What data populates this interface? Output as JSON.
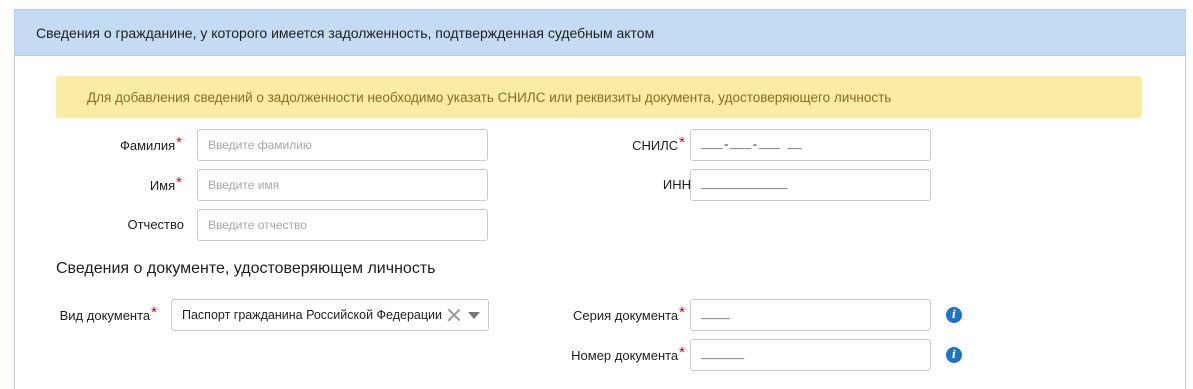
{
  "panel": {
    "title": "Сведения о гражданине, у которого имеется задолженность, подтвержденная судебным актом"
  },
  "notice": {
    "text": "Для добавления сведений о задолженности необходимо указать СНИЛС или реквизиты документа, удостоверяющего личность"
  },
  "person": {
    "surname": {
      "label": "Фамилия",
      "required": "*",
      "placeholder": "Введите фамилию",
      "value": ""
    },
    "name": {
      "label": "Имя",
      "required": "*",
      "placeholder": "Введите имя",
      "value": ""
    },
    "patronymic": {
      "label": "Отчество",
      "placeholder": "Введите отчество",
      "value": ""
    },
    "snils": {
      "label": "СНИЛС",
      "required": "*",
      "value": "___-___-___ __"
    },
    "inn": {
      "label": "ИНН",
      "value": "____________"
    }
  },
  "document": {
    "section_title": "Сведения о документе, удостоверяющем личность",
    "type": {
      "label": "Вид документа",
      "required": "*",
      "selected": "Паспорт гражданина Российской Федерации"
    },
    "series": {
      "label": "Серия документа",
      "required": "*",
      "value": "____",
      "info_icon": "i"
    },
    "number": {
      "label": "Номер документа",
      "required": "*",
      "value": "______",
      "info_icon": "i"
    }
  }
}
